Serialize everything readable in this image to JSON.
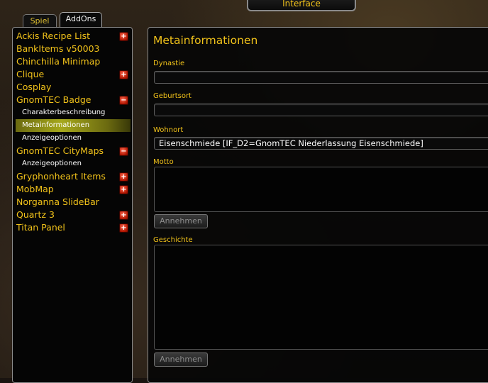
{
  "header": {
    "title": "Interface"
  },
  "tabs": [
    {
      "label": "Spiel"
    },
    {
      "label": "AddOns"
    }
  ],
  "addon_list": [
    {
      "label": "Ackis Recipe List",
      "expand": "+"
    },
    {
      "label": "BankItems v50003"
    },
    {
      "label": "Chinchilla Minimap"
    },
    {
      "label": "Clique",
      "expand": "+"
    },
    {
      "label": "Cosplay"
    },
    {
      "label": "GnomTEC Badge",
      "expand": "−"
    },
    {
      "label": "Charakterbeschreibung",
      "sub": true
    },
    {
      "label": "Metainformationen",
      "sub": true,
      "selected": true
    },
    {
      "label": "Anzeigeoptionen",
      "sub": true
    },
    {
      "label": "GnomTEC CityMaps",
      "expand": "−"
    },
    {
      "label": "Anzeigeoptionen",
      "sub": true
    },
    {
      "label": "Gryphonheart Items",
      "expand": "+"
    },
    {
      "label": "MobMap",
      "expand": "+"
    },
    {
      "label": "Norganna SlideBar"
    },
    {
      "label": "Quartz 3",
      "expand": "+"
    },
    {
      "label": "Titan Panel",
      "expand": "+"
    }
  ],
  "panel": {
    "title": "Metainformationen",
    "dynastie_label": "Dynastie",
    "dynastie_value": "",
    "geburtsort_label": "Geburtsort",
    "geburtsort_value": "",
    "wohnort_label": "Wohnort",
    "wohnort_value": "Eisenschmiede [IF_D2=GnomTEC Niederlassung Eisenschmiede]",
    "motto_label": "Motto",
    "motto_button": "Annehmen",
    "geschichte_label": "Geschichte",
    "geschichte_button": "Annehmen"
  },
  "colors": {
    "accent": "#f1c21a",
    "selected_highlight": "#a6a81c",
    "expand_button": "#b01500"
  }
}
